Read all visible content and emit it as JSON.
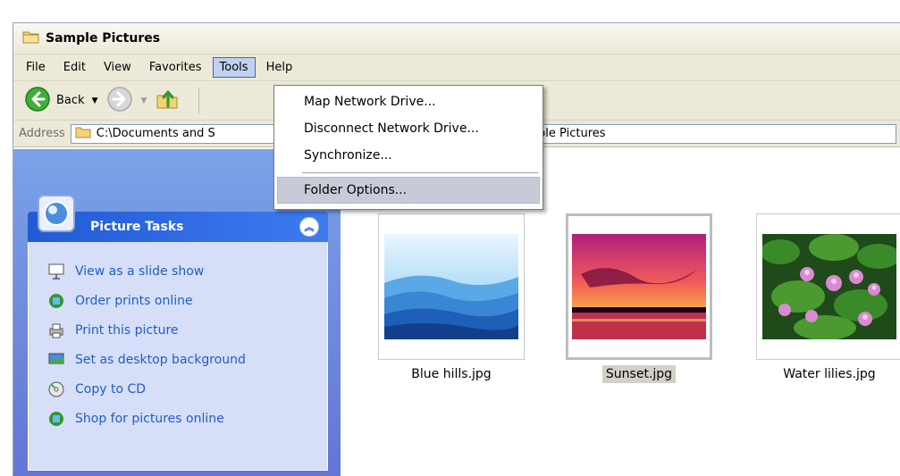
{
  "window": {
    "title": "Sample Pictures"
  },
  "menubar": {
    "items": [
      "File",
      "Edit",
      "View",
      "Favorites",
      "Tools",
      "Help"
    ],
    "active": "Tools"
  },
  "toolbar": {
    "back_label": "Back"
  },
  "address": {
    "label": "Address",
    "path_left": "C:\\Documents and S",
    "path_right": "ures\\Sample Pictures"
  },
  "tools_menu": {
    "items": [
      {
        "label": "Map Network Drive...",
        "highlighted": false
      },
      {
        "label": "Disconnect Network Drive...",
        "highlighted": false
      },
      {
        "label": "Synchronize...",
        "highlighted": false
      },
      {
        "label": "Folder Options...",
        "highlighted": true
      }
    ]
  },
  "task_pane": {
    "header": "Picture Tasks",
    "items": [
      {
        "label": "View as a slide show",
        "icon": "slideshow-icon"
      },
      {
        "label": "Order prints online",
        "icon": "order-prints-icon"
      },
      {
        "label": "Print this picture",
        "icon": "printer-icon"
      },
      {
        "label": "Set as desktop background",
        "icon": "desktop-background-icon"
      },
      {
        "label": "Copy to CD",
        "icon": "cd-icon"
      },
      {
        "label": "Shop for pictures online",
        "icon": "shop-icon"
      }
    ]
  },
  "files": [
    {
      "name": "Blue hills.jpg",
      "selected": false
    },
    {
      "name": "Sunset.jpg",
      "selected": true
    },
    {
      "name": "Water lilies.jpg",
      "selected": false
    }
  ],
  "colors": {
    "xp_blue": "#225ad3",
    "task_link": "#215dc6",
    "menu_highlight": "#c7cbd8"
  }
}
